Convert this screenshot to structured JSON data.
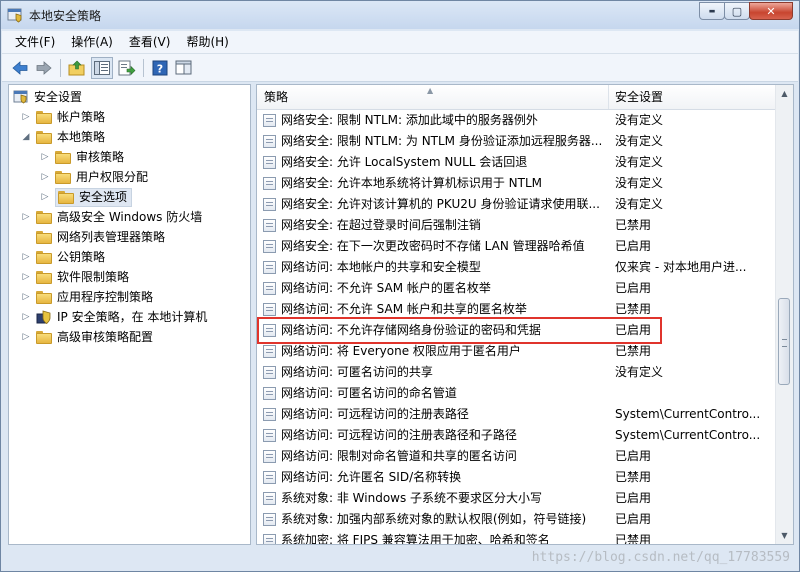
{
  "window": {
    "title": "本地安全策略"
  },
  "caption": {
    "minimize": "▬",
    "maximize": "▢",
    "close": "✕"
  },
  "menu": [
    "文件(F)",
    "操作(A)",
    "查看(V)",
    "帮助(H)"
  ],
  "toolbar": [
    "back-arrow-icon",
    "forward-arrow-icon",
    "up-folder-icon",
    "show-hide-tree-icon",
    "export-list-icon",
    "help-icon",
    "properties-pane-icon"
  ],
  "tree": [
    {
      "label": "安全设置",
      "level": 0,
      "expander": "open"
    },
    {
      "label": "帐户策略",
      "level": 1,
      "expander": "closed"
    },
    {
      "label": "本地策略",
      "level": 1,
      "expander": "open"
    },
    {
      "label": "审核策略",
      "level": 2,
      "expander": "closed"
    },
    {
      "label": "用户权限分配",
      "level": 2,
      "expander": "closed"
    },
    {
      "label": "安全选项",
      "level": 2,
      "expander": "closed",
      "selected": true
    },
    {
      "label": "高级安全 Windows 防火墙",
      "level": 1,
      "expander": "closed"
    },
    {
      "label": "网络列表管理器策略",
      "level": 1,
      "expander": "none"
    },
    {
      "label": "公钥策略",
      "level": 1,
      "expander": "closed"
    },
    {
      "label": "软件限制策略",
      "level": 1,
      "expander": "closed"
    },
    {
      "label": "应用程序控制策略",
      "level": 1,
      "expander": "closed"
    },
    {
      "label": "IP 安全策略，在 本地计算机",
      "level": 1,
      "expander": "closed"
    },
    {
      "label": "高级审核策略配置",
      "level": 1,
      "expander": "closed"
    }
  ],
  "list": {
    "col_policy": "策略",
    "col_setting": "安全设置",
    "rows": [
      {
        "policy": "网络安全: 限制 NTLM: 添加此域中的服务器例外",
        "setting": "没有定义"
      },
      {
        "policy": "网络安全: 限制 NTLM: 为 NTLM 身份验证添加远程服务器...",
        "setting": "没有定义"
      },
      {
        "policy": "网络安全: 允许 LocalSystem NULL 会话回退",
        "setting": "没有定义"
      },
      {
        "policy": "网络安全: 允许本地系统将计算机标识用于 NTLM",
        "setting": "没有定义"
      },
      {
        "policy": "网络安全: 允许对该计算机的 PKU2U 身份验证请求使用联...",
        "setting": "没有定义"
      },
      {
        "policy": "网络安全: 在超过登录时间后强制注销",
        "setting": "已禁用"
      },
      {
        "policy": "网络安全: 在下一次更改密码时不存储 LAN 管理器哈希值",
        "setting": "已启用"
      },
      {
        "policy": "网络访问: 本地帐户的共享和安全模型",
        "setting": "仅来宾 - 对本地用户进..."
      },
      {
        "policy": "网络访问: 不允许 SAM 帐户的匿名枚举",
        "setting": "已启用"
      },
      {
        "policy": "网络访问: 不允许 SAM 帐户和共享的匿名枚举",
        "setting": "已禁用"
      },
      {
        "policy": "网络访问: 不允许存储网络身份验证的密码和凭据",
        "setting": "已启用",
        "highlight": true
      },
      {
        "policy": "网络访问: 将 Everyone 权限应用于匿名用户",
        "setting": "已禁用"
      },
      {
        "policy": "网络访问: 可匿名访问的共享",
        "setting": "没有定义"
      },
      {
        "policy": "网络访问: 可匿名访问的命名管道",
        "setting": ""
      },
      {
        "policy": "网络访问: 可远程访问的注册表路径",
        "setting": "System\\CurrentContro..."
      },
      {
        "policy": "网络访问: 可远程访问的注册表路径和子路径",
        "setting": "System\\CurrentContro..."
      },
      {
        "policy": "网络访问: 限制对命名管道和共享的匿名访问",
        "setting": "已启用"
      },
      {
        "policy": "网络访问: 允许匿名 SID/名称转换",
        "setting": "已禁用"
      },
      {
        "policy": "系统对象: 非 Windows 子系统不要求区分大小写",
        "setting": "已启用"
      },
      {
        "policy": "系统对象: 加强内部系统对象的默认权限(例如，符号链接)",
        "setting": "已启用"
      },
      {
        "policy": "系统加密: 将 FIPS 兼容算法用于加密、哈希和签名",
        "setting": "已禁用"
      }
    ]
  },
  "scrollbar": {
    "position": 0.55
  },
  "watermark": "https://blog.csdn.net/qq_17783559"
}
